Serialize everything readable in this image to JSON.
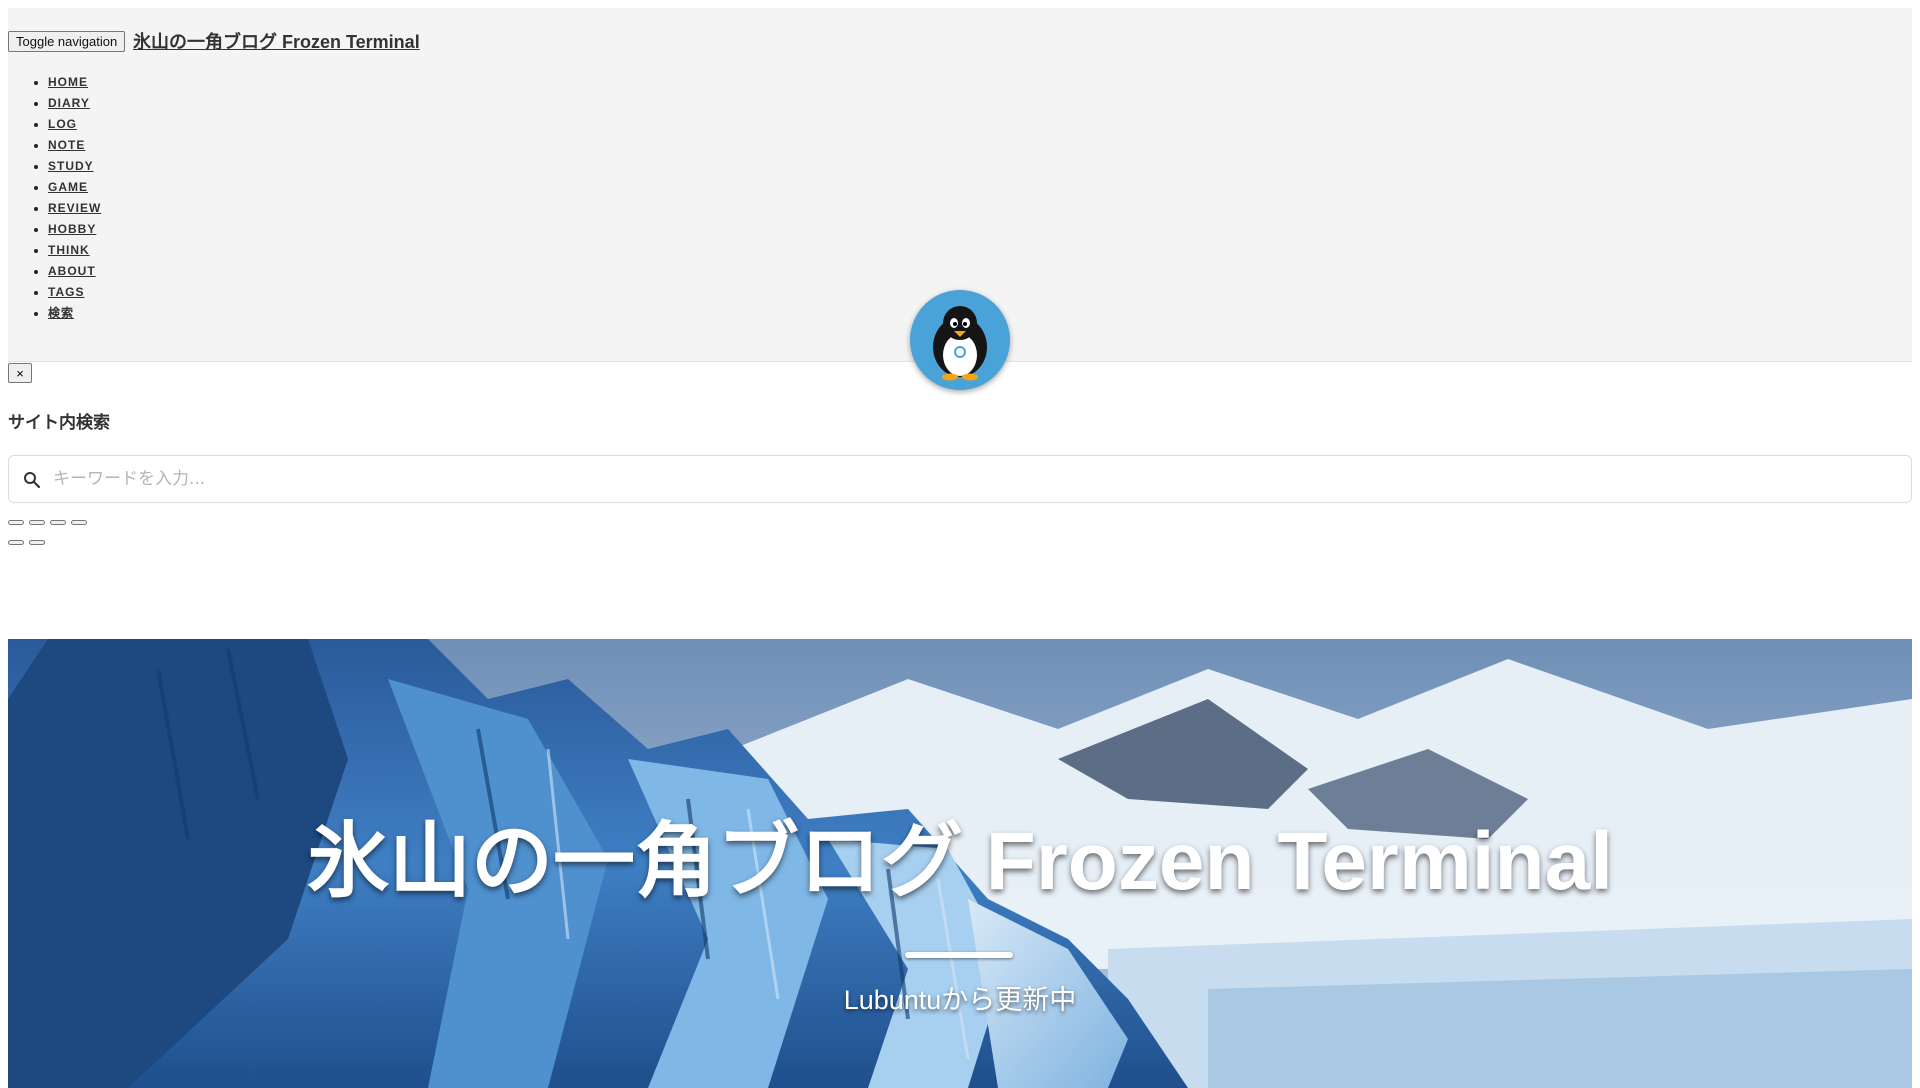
{
  "navbar": {
    "toggle_label": "Toggle navigation",
    "brand": "氷山の一角ブログ Frozen Terminal",
    "items": [
      {
        "label": "HOME"
      },
      {
        "label": "DIARY"
      },
      {
        "label": "LOG"
      },
      {
        "label": "NOTE"
      },
      {
        "label": "STUDY"
      },
      {
        "label": "GAME"
      },
      {
        "label": "REVIEW"
      },
      {
        "label": "HOBBY"
      },
      {
        "label": "THINK"
      },
      {
        "label": "ABOUT"
      },
      {
        "label": "TAGS"
      },
      {
        "label": "検索"
      }
    ]
  },
  "avatar": {
    "icon": "penguin-icon"
  },
  "search_panel": {
    "close_label": "×",
    "title": "サイト内検索",
    "placeholder": "キーワードを入力...",
    "icon": "search-icon"
  },
  "hero": {
    "title": "氷山の一角ブログ Frozen Terminal",
    "subtitle": "Lubuntuから更新中"
  },
  "colors": {
    "navbar_bg": "#f4f4f4",
    "avatar_bg": "#4aa3d8",
    "hero_sky": "#2c5e9e"
  }
}
